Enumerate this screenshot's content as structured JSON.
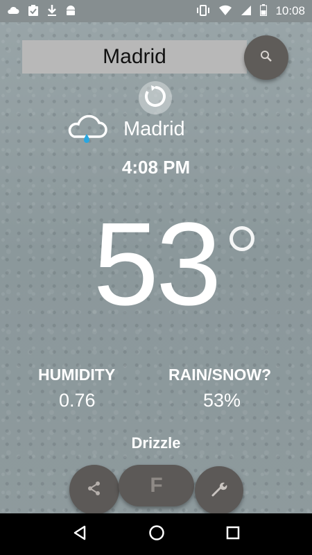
{
  "status_bar": {
    "left_icons": [
      "cloud-icon",
      "clipboard-check-icon",
      "download-icon",
      "android-icon"
    ],
    "right_icons": [
      "vibrate-icon",
      "wifi-icon",
      "signal-icon",
      "battery-icon"
    ],
    "time": "10:08"
  },
  "search": {
    "value": "Madrid",
    "button_icon": "search-icon"
  },
  "weather": {
    "condition_icon": "rain-cloud-icon",
    "city": "Madrid",
    "local_time": "4:08 PM",
    "temperature": "53",
    "humidity_label": "HUMIDITY",
    "humidity_value": "0.76",
    "precip_label": "RAIN/SNOW?",
    "precip_value": "53%",
    "description": "Drizzle"
  },
  "actions": {
    "share_icon": "share-icon",
    "unit_label": "F",
    "settings_icon": "wrench-icon",
    "refresh_icon": "refresh-icon"
  },
  "nav": {
    "back_icon": "back-icon",
    "home_icon": "home-icon",
    "recents_icon": "recents-icon"
  },
  "colors": {
    "fab": "#5c5957",
    "search_bg": "#b8b8b8",
    "text": "#ffffff"
  }
}
